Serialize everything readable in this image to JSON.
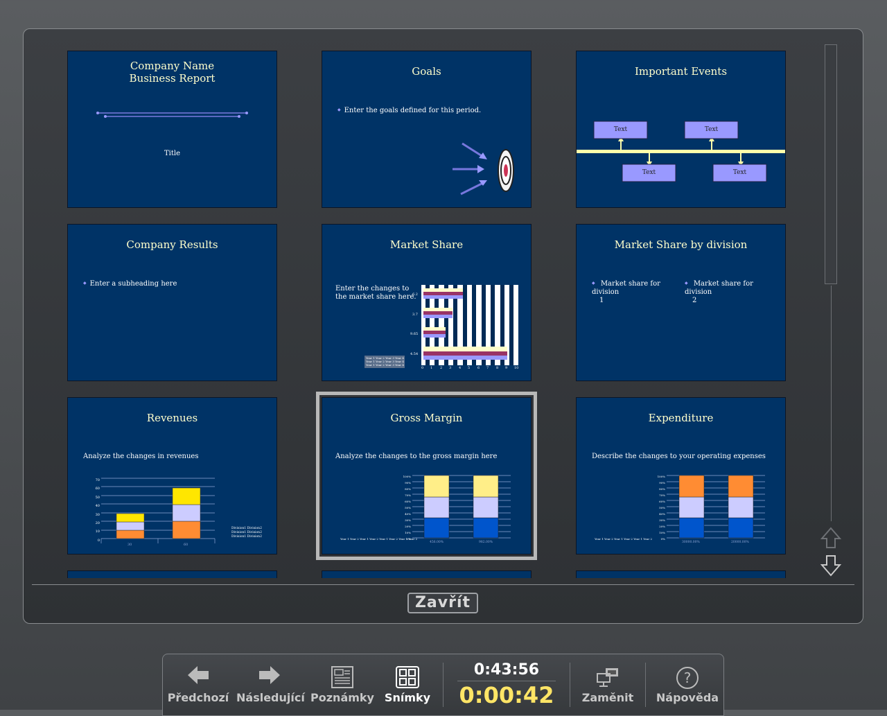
{
  "slides": [
    {
      "title_lines": [
        "Company Name",
        "Business Report"
      ],
      "subtitle": "Title"
    },
    {
      "title": "Goals",
      "bullet": "Enter the goals defined for this period."
    },
    {
      "title": "Important Events",
      "boxes": [
        "Text",
        "Text",
        "Text",
        "Text"
      ]
    },
    {
      "title": "Company Results",
      "bullet": "Enter a subheading here"
    },
    {
      "title": "Market Share",
      "body": [
        "Enter the changes to",
        "the market share here."
      ],
      "chart_y_labels": [
        "6.2",
        "3.7",
        "9.65",
        "4.54"
      ],
      "chart_x_labels": [
        "0",
        "1",
        "2",
        "3",
        "4",
        "5",
        "6",
        "7",
        "8",
        "9",
        "10"
      ],
      "legend": [
        "Year 1  Year 2  Year 3  Year 4",
        "Year 1  Year 2  Year 3  Year 4",
        "Year 1  Year 2  Year 3  Year 4"
      ]
    },
    {
      "title": "Market Share by division",
      "bullets": [
        [
          "Market share for division",
          "1"
        ],
        [
          "Market share for division",
          "2"
        ]
      ]
    },
    {
      "title": "Revenues",
      "body": "Analyze the changes in revenues",
      "y_ticks": [
        "70",
        "60",
        "50",
        "40",
        "30",
        "20",
        "10",
        "0"
      ],
      "x_labels": [
        "30",
        "60"
      ],
      "legend": [
        "Division1 Division2",
        "Division1 Division2",
        "Division1 Division2"
      ]
    },
    {
      "title": "Gross Margin",
      "body": "Analyze the changes to the gross margin here",
      "y_ticks": [
        "100%",
        "90%",
        "80%",
        "70%",
        "60%",
        "50%",
        "40%",
        "30%",
        "20%",
        "10%",
        "0%"
      ],
      "x_labels": [
        "456.00%",
        "982.00%"
      ],
      "legend": [
        "Year 1  Year 2",
        "Year 1  Year 2",
        "Year 1  Year 2",
        "Year 1  Year 2"
      ]
    },
    {
      "title": "Expenditure",
      "body": "Describe the changes to your operating expenses",
      "y_ticks": [
        "100%",
        "90%",
        "80%",
        "70%",
        "60%",
        "50%",
        "40%",
        "30%",
        "20%",
        "10%",
        "0%"
      ],
      "x_labels": [
        "30000.00%",
        "20000.00%"
      ],
      "legend": [
        "Year 1  Year 2",
        "Year 1  Year 2",
        "Year 1  Year 2"
      ]
    }
  ],
  "close_label": "Zavřít",
  "toolbar": {
    "prev": "Předchozí",
    "next": "Následující",
    "notes": "Poznámky",
    "slides": "Snímky",
    "clock_time": "0:43:56",
    "elapsed": "0:00:42",
    "swap": "Zaměnit",
    "help": "Nápověda"
  },
  "colors": {
    "slide_bg": "#003366",
    "title": "#ffffcc",
    "accent": "#9999ff",
    "elapsed": "#ffe566"
  },
  "icons": [
    "arrow-left-icon",
    "arrow-right-icon",
    "notes-icon",
    "slides-grid-icon",
    "swap-displays-icon",
    "help-icon",
    "scroll-up-icon",
    "scroll-down-icon"
  ]
}
